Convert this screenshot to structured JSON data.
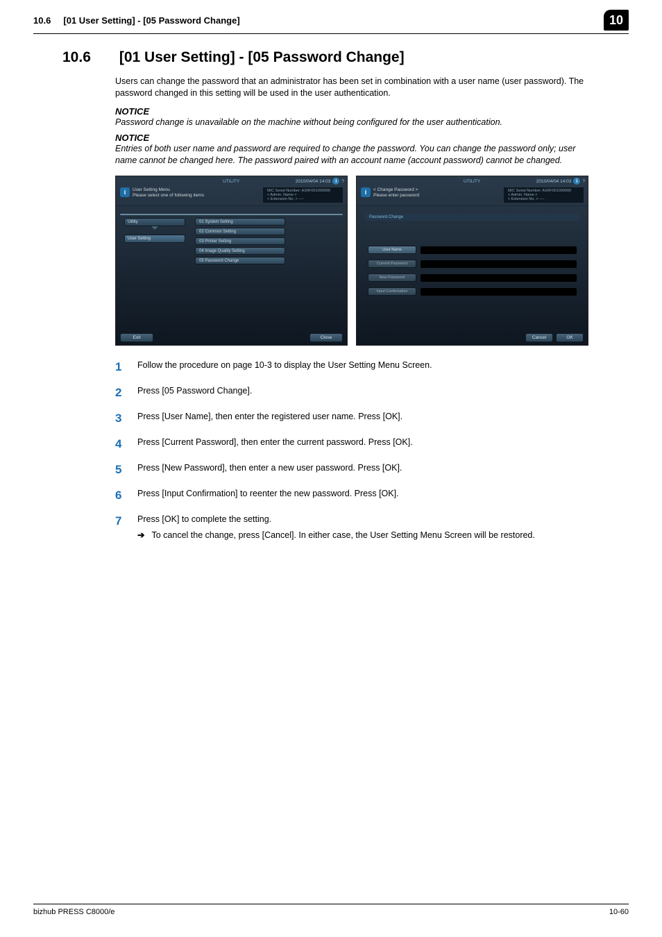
{
  "header": {
    "section_ref": "10.6",
    "section_path": "[01 User Setting] - [05 Password Change]",
    "chapter_badge": "10"
  },
  "title": {
    "number": "10.6",
    "text": "[01 User Setting] - [05 Password Change]"
  },
  "intro": "Users can change the password that an administrator has been set in combination with a user name (user password). The password changed in this setting will be used in the user authentication.",
  "notice1_label": "NOTICE",
  "notice1_text": "Password change is unavailable on the machine without being configured for the user authentication.",
  "notice2_label": "NOTICE",
  "notice2_text": "Entries of both user name and password are required to change the password. You can change the password only; user name cannot be changed here. The password paired with an account name (account password) cannot be changed.",
  "screens": {
    "common": {
      "utility_label": "UTILITY",
      "datetime": "2010/04/04 14:03",
      "serial_label": "M/C Serial Number:",
      "serial_value": "A1RF001000000",
      "admin_label": "< Admin. Name >",
      "ext_label": "< Extension No. > ----"
    },
    "left": {
      "info_line1": "User Setting Menu",
      "info_line2": "Please select one of following items",
      "side_tab_top": "Utility",
      "side_tab_selected": "User Setting",
      "menu_items": [
        "01 System Setting",
        "02 Common Setting",
        "03 Printer Setting",
        "04 Image Quality Setting",
        "05 Password Change"
      ],
      "exit_btn": "Exit",
      "close_btn": "Close"
    },
    "right": {
      "info_line1": "< Change Password >",
      "info_line2": "Please enter password",
      "panel_title": "Password Change",
      "fields": [
        "User Name",
        "Current Password",
        "New Password",
        "Input Confirmation"
      ],
      "cancel_btn": "Cancel",
      "ok_btn": "OK"
    }
  },
  "steps": [
    "Follow the procedure on page 10-3 to display the User Setting Menu Screen.",
    "Press [05 Password Change].",
    "Press [User Name], then enter the registered user name. Press [OK].",
    "Press [Current Password], then enter the current password. Press [OK].",
    "Press [New Password], then enter a new user password. Press [OK].",
    "Press [Input Confirmation] to reenter the new password. Press [OK].",
    "Press [OK] to complete the setting."
  ],
  "step7_sub": "To cancel the change, press [Cancel]. In either case, the User Setting Menu Screen will be restored.",
  "footer": {
    "left": "bizhub PRESS C8000/e",
    "right": "10-60"
  }
}
